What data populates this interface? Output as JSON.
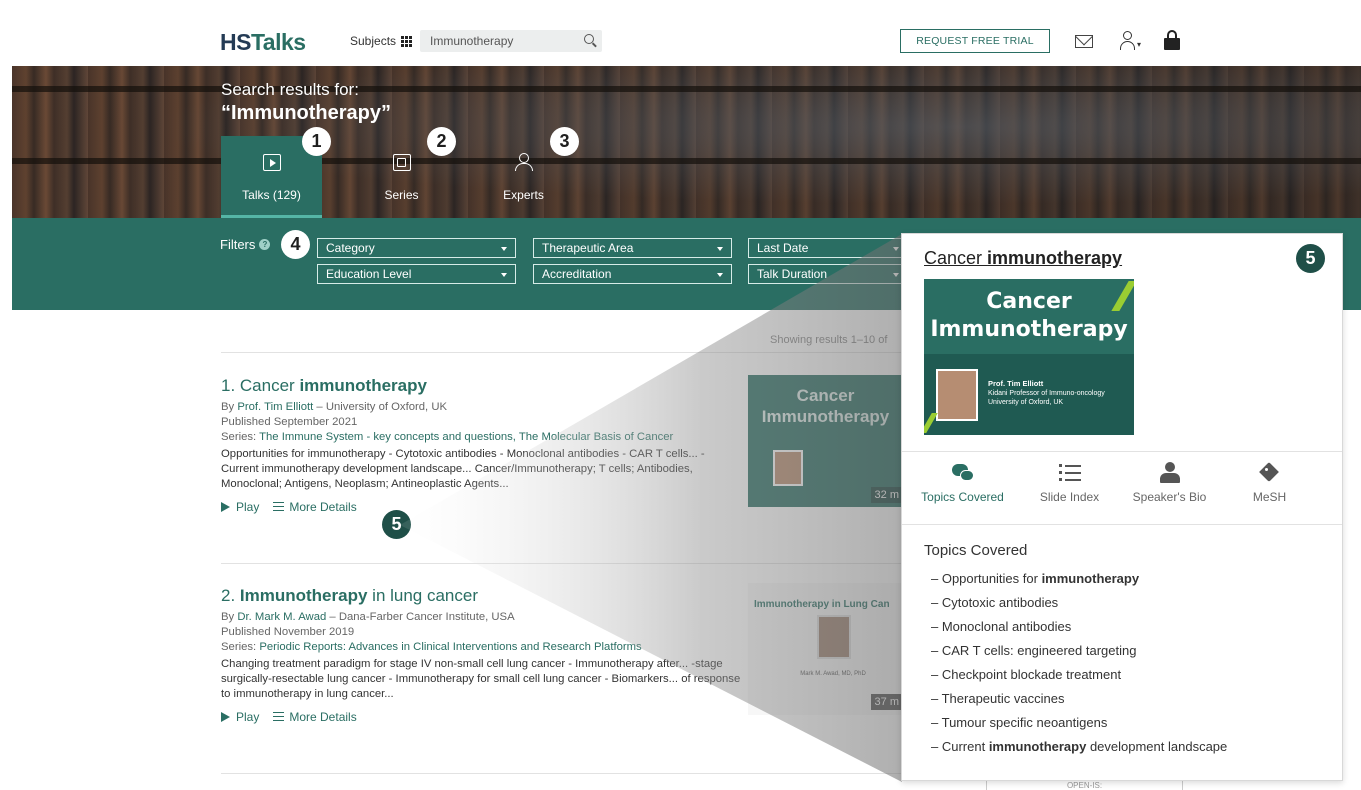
{
  "header": {
    "logo_left": "HS",
    "logo_right": "Talks",
    "subjects_label": "Subjects",
    "search_value": "Immunotherapy",
    "trial_button": "REQUEST FREE TRIAL"
  },
  "hero": {
    "title": "Search results for:",
    "query": "“Immunotherapy”",
    "tabs": [
      {
        "label": "Talks (129)",
        "active": true
      },
      {
        "label": "Series",
        "active": false
      },
      {
        "label": "Experts",
        "active": false
      }
    ]
  },
  "badges": [
    "1",
    "2",
    "3",
    "4",
    "5"
  ],
  "filters": {
    "label": "Filters",
    "dropdowns": [
      "Category",
      "Therapeutic Area",
      "Last Date",
      "Education Level",
      "Accreditation",
      "Talk Duration"
    ]
  },
  "results": {
    "showing": "Showing results 1–10 of",
    "items": [
      {
        "num": "1. Cancer ",
        "title_bold": "immunotherapy",
        "title_rest": "",
        "by_prefix": "By ",
        "author": "Prof. Tim Elliott",
        "affiliation": " – University of Oxford, UK",
        "published": "Published September 2021",
        "series_prefix": "Series: ",
        "series": "The Immune System - key concepts and questions, The Molecular Basis of Cancer",
        "desc": "Opportunities for immunotherapy - Cytotoxic antibodies - Monoclonal antibodies - CAR T cells... - Current immunotherapy development landscape... Cancer/Immunotherapy; T cells; Antibodies, Monoclonal; Antigens, Neoplasm; Antineoplastic Agents...",
        "thumb_title": "Cancer Immunotherapy",
        "thumb_speaker": "Prof. Tim Elliott",
        "duration": "32 m"
      },
      {
        "num": "2. ",
        "title_bold": "Immunotherapy",
        "title_rest": " in lung cancer",
        "by_prefix": "By ",
        "author": "Dr. Mark M. Awad",
        "affiliation": " – Dana-Farber Cancer Institute, USA",
        "published": "Published November 2019",
        "series_prefix": "Series: ",
        "series": "Periodic Reports: Advances in Clinical Interventions and Research Platforms",
        "desc": "Changing treatment paradigm for stage IV non-small cell lung cancer - Immunotherapy after... -stage surgically-resectable lung cancer - Immunotherapy for small cell lung cancer - Biomarkers... of response to immunotherapy in lung cancer...",
        "thumb_title": "Immunotherapy in Lung Can",
        "thumb_speaker": "Mark M. Awad, MD, PhD",
        "duration": "37 m"
      }
    ],
    "play": "Play",
    "more": "More Details"
  },
  "popup": {
    "title_prefix": "Cancer ",
    "title_bold": "immunotherapy",
    "thumb_title": "Cancer Immunotherapy",
    "thumb_speaker": "Prof. Tim Elliott",
    "thumb_role": "Kidani Professor of Immuno-oncology",
    "thumb_affil": "University of Oxford, UK",
    "tabs": [
      "Topics Covered",
      "Slide Index",
      "Speaker's Bio",
      "MeSH"
    ],
    "section_title": "Topics Covered",
    "topics": [
      [
        "– Opportunities for ",
        "immunotherapy",
        ""
      ],
      [
        "– Cytotoxic antibodies",
        "",
        ""
      ],
      [
        "– Monoclonal antibodies",
        "",
        ""
      ],
      [
        "– CAR T cells: engineered targeting",
        "",
        ""
      ],
      [
        "– Checkpoint blockade treatment",
        "",
        ""
      ],
      [
        "– Therapeutic vaccines",
        "",
        ""
      ],
      [
        "– Tumour specific neoantigens",
        "",
        ""
      ],
      [
        "– Current ",
        "immunotherapy",
        " development landscape"
      ]
    ]
  },
  "footer_fragment": "OPEN-IS:",
  "colors": {
    "brand": "#2a6e63",
    "navy": "#243b55"
  }
}
